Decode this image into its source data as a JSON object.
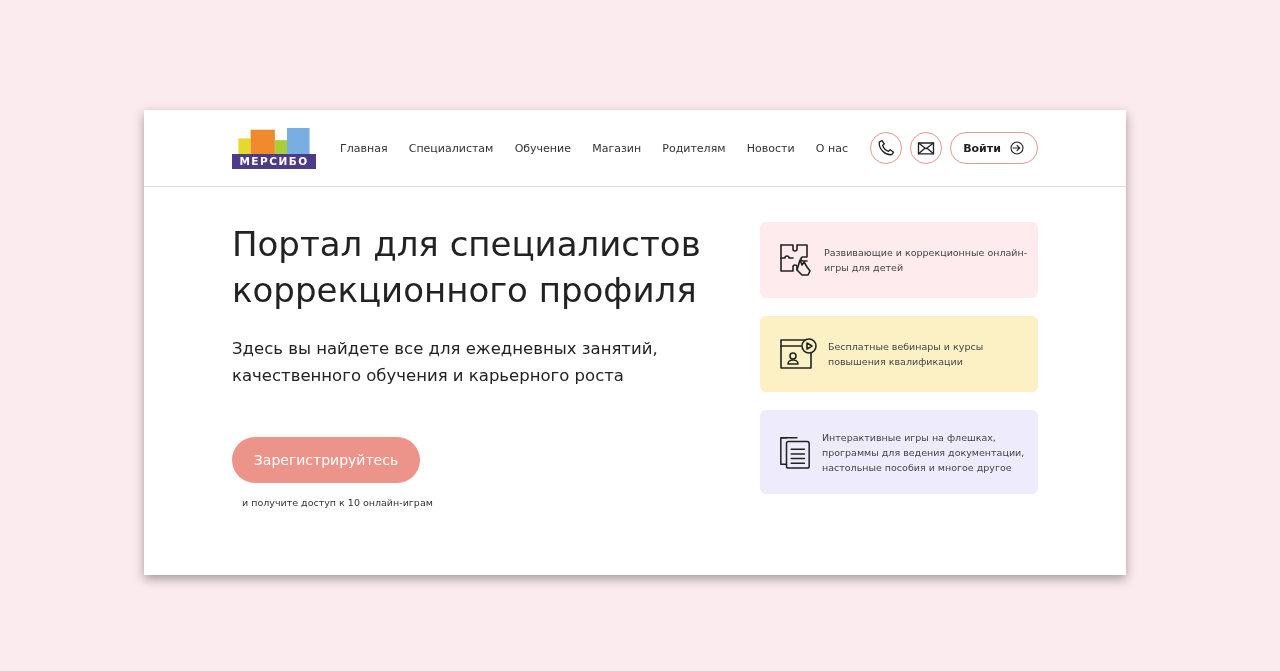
{
  "logo": {
    "text": "МЕРСИБО"
  },
  "nav": [
    {
      "label": "Главная"
    },
    {
      "label": "Специалистам"
    },
    {
      "label": "Обучение"
    },
    {
      "label": "Магазин"
    },
    {
      "label": "Родителям"
    },
    {
      "label": "Новости"
    },
    {
      "label": "О нас"
    }
  ],
  "login": {
    "label": "Войти"
  },
  "hero": {
    "title": "Портал для специалистов коррекционного профиля",
    "subtitle": "Здесь вы найдете все для ежедневных занятий, качественного обучения и карьерного роста",
    "button": "Зарегистрируйтесь",
    "note": "и получите доступ к 10 онлайн-играм"
  },
  "features": [
    {
      "kind": "puzzle",
      "color": "#fdebee",
      "text": "Развивающие и коррекционные онлайн-игры для детей"
    },
    {
      "kind": "webinar",
      "color": "#fcf1c4",
      "text": "Бесплатные вебинары и курсы повышения квалификации"
    },
    {
      "kind": "documents",
      "color": "#eeebfc",
      "text": "Интерактивные игры на флешках, программы для ведения документации, настольные пособия и многое другое"
    }
  ]
}
